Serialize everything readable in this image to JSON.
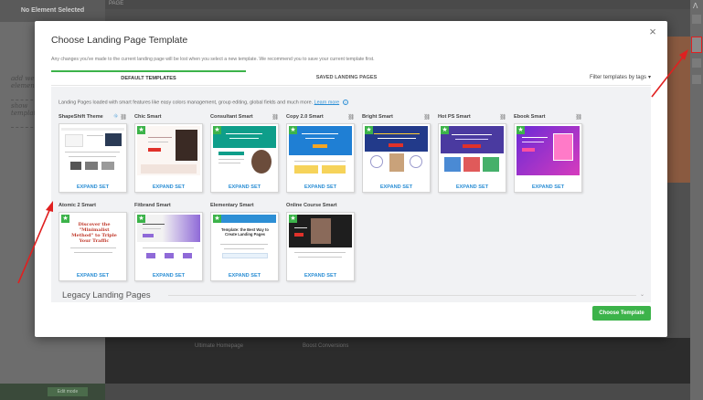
{
  "editor": {
    "left_header": "No Element Selected",
    "page_tab": "PAGE",
    "scribble_1": "add web elements",
    "scribble_2": "show templates",
    "bottom_button": "Edit mode",
    "bg_texts": [
      "Ultimate Homepage",
      "Boost Conversions"
    ],
    "logo": "Λ"
  },
  "modal": {
    "title": "Choose Landing Page Template",
    "subtitle": "Any changes you've made to the current landing page will be lost when you select a new template. We recommend you to save your current template first.",
    "close_icon": "×",
    "tabs": [
      {
        "label": "DEFAULT TEMPLATES",
        "active": true
      },
      {
        "label": "SAVED LANDING PAGES",
        "active": false
      }
    ],
    "filter_label": "Filter templates by tags",
    "filter_icon": "chevron-down-icon",
    "info_text": "Landing Pages loaded with smart features like easy colors management, group editing, global fields and much more.",
    "learn_more": "Learn more",
    "expand_label": "EXPAND SET",
    "templates": [
      {
        "name": "ShapeShift Theme",
        "star": false,
        "selected": true,
        "tree": true,
        "badge": true
      },
      {
        "name": "Chic Smart",
        "star": true,
        "tree": false
      },
      {
        "name": "Consultant Smart",
        "star": true,
        "tree": true
      },
      {
        "name": "Copy 2.0 Smart",
        "star": true,
        "tree": true
      },
      {
        "name": "Bright Smart",
        "star": true,
        "tree": true
      },
      {
        "name": "Hot PS Smart",
        "star": true,
        "tree": true
      },
      {
        "name": "Ebook Smart",
        "star": true,
        "tree": true
      },
      {
        "name": "Atomic 2 Smart",
        "star": true,
        "tree": false
      },
      {
        "name": "Fitbrand Smart",
        "star": true,
        "tree": false
      },
      {
        "name": "Elementary Smart",
        "star": true,
        "tree": false
      },
      {
        "name": "Online Course Smart",
        "star": true,
        "tree": false
      }
    ],
    "preview_texts": {
      "atomic": "Discover the \"Minimalist Method\" to Triple Your Traffic",
      "bright": "Unveiled... the NEW Way to Boost Your Website's Conversion Rates",
      "elementary": "Template: the Best Way to Create Landing Pages"
    },
    "legacy_title": "Legacy Landing Pages",
    "choose_button": "Choose Template"
  },
  "colors": {
    "accent_green": "#3cb34a",
    "link_blue": "#2d8fd5",
    "annotation_red": "#e02020"
  }
}
